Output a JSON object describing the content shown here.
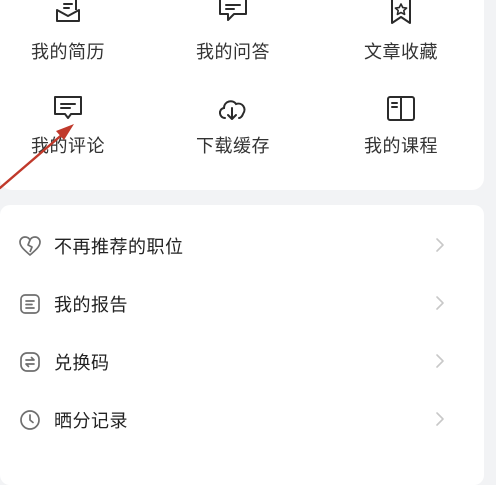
{
  "grid": {
    "items": [
      {
        "label": "我的简历",
        "icon": "resume-icon"
      },
      {
        "label": "我的问答",
        "icon": "chat-icon"
      },
      {
        "label": "文章收藏",
        "icon": "bookmark-icon"
      },
      {
        "label": "我的评论",
        "icon": "comment-icon"
      },
      {
        "label": "下载缓存",
        "icon": "cloud-download-icon"
      },
      {
        "label": "我的课程",
        "icon": "book-icon"
      }
    ]
  },
  "menu": {
    "items": [
      {
        "label": "不再推荐的职位",
        "icon": "broken-heart-icon"
      },
      {
        "label": "我的报告",
        "icon": "report-icon"
      },
      {
        "label": "兑换码",
        "icon": "exchange-icon"
      },
      {
        "label": "晒分记录",
        "icon": "clock-icon"
      }
    ]
  },
  "colors": {
    "annotation_arrow": "#c0392b",
    "icon": "#2b2b2b",
    "chevron": "#c8c8c8"
  }
}
